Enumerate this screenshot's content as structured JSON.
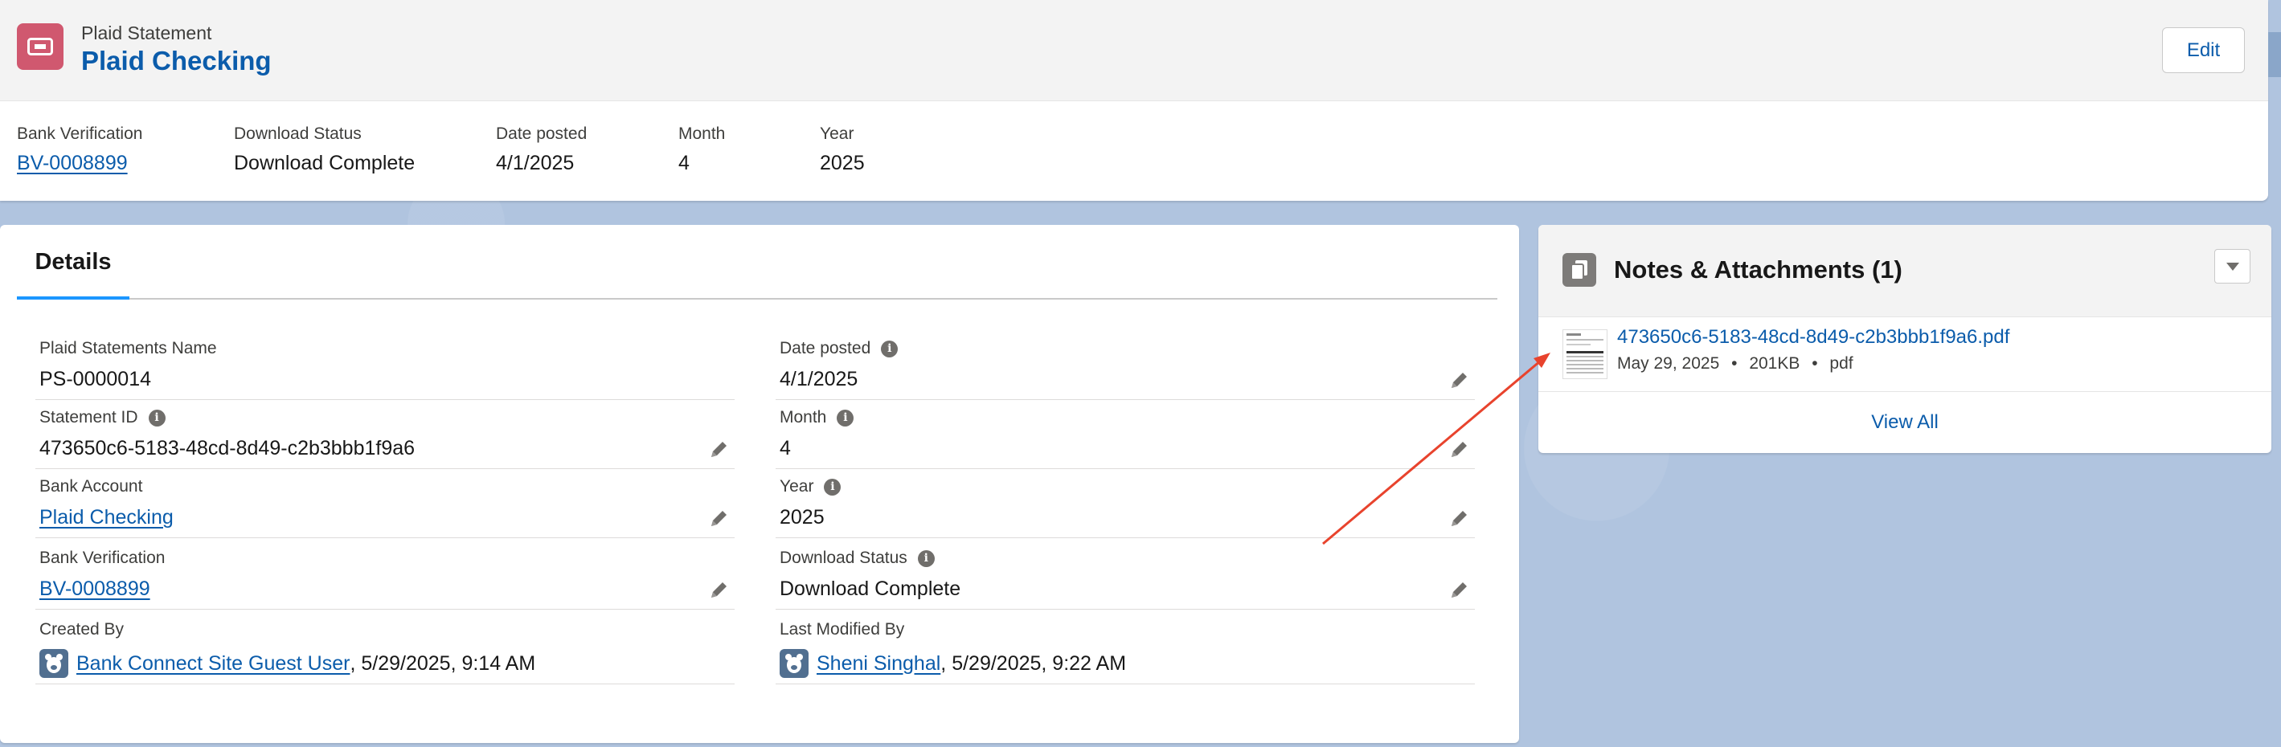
{
  "header": {
    "object_type": "Plaid Statement",
    "record_title": "Plaid Checking",
    "edit_label": "Edit",
    "fields": [
      {
        "label": "Bank Verification",
        "value": "BV-0008899",
        "link": true
      },
      {
        "label": "Download Status",
        "value": "Download Complete",
        "link": false
      },
      {
        "label": "Date posted",
        "value": "4/1/2025",
        "link": false
      },
      {
        "label": "Month",
        "value": "4",
        "link": false
      },
      {
        "label": "Year",
        "value": "2025",
        "link": false
      }
    ]
  },
  "details": {
    "tab_label": "Details",
    "left": [
      {
        "label": "Plaid Statements Name",
        "value": "PS-0000014"
      },
      {
        "label": "Statement ID",
        "value": "473650c6-5183-48cd-8d49-c2b3bbb1f9a6"
      },
      {
        "label": "Bank Account",
        "value": "Plaid Checking"
      },
      {
        "label": "Bank Verification",
        "value": "BV-0008899"
      },
      {
        "label": "Created By",
        "user": "Bank Connect Site Guest User",
        "stamp": ", 5/29/2025, 9:14 AM"
      }
    ],
    "right": [
      {
        "label": "Date posted",
        "value": "4/1/2025"
      },
      {
        "label": "Month",
        "value": "4"
      },
      {
        "label": "Year",
        "value": "2025"
      },
      {
        "label": "Download Status",
        "value": "Download Complete"
      },
      {
        "label": "Last Modified By",
        "user": "Sheni Singhal",
        "stamp": ", 5/29/2025, 9:22 AM"
      }
    ]
  },
  "notes": {
    "title": "Notes & Attachments (1)",
    "file": {
      "name": "473650c6-5183-48cd-8d49-c2b3bbb1f9a6.pdf",
      "date": "May 29, 2025",
      "size": "201KB",
      "ext": "pdf",
      "sep": "•"
    },
    "view_all": "View All"
  },
  "colors": {
    "brand_link": "#0b5cab",
    "object_icon": "#d0586f",
    "tab_underline": "#1b96ff",
    "annotation_arrow": "#e8432d",
    "background": "#b0c4df"
  },
  "icons": {
    "object": "ticket-icon",
    "info": "info-icon",
    "edit": "pencil-icon",
    "user": "bear-avatar-icon",
    "notes": "document-copy-icon",
    "dropdown": "chevron-down-icon"
  }
}
